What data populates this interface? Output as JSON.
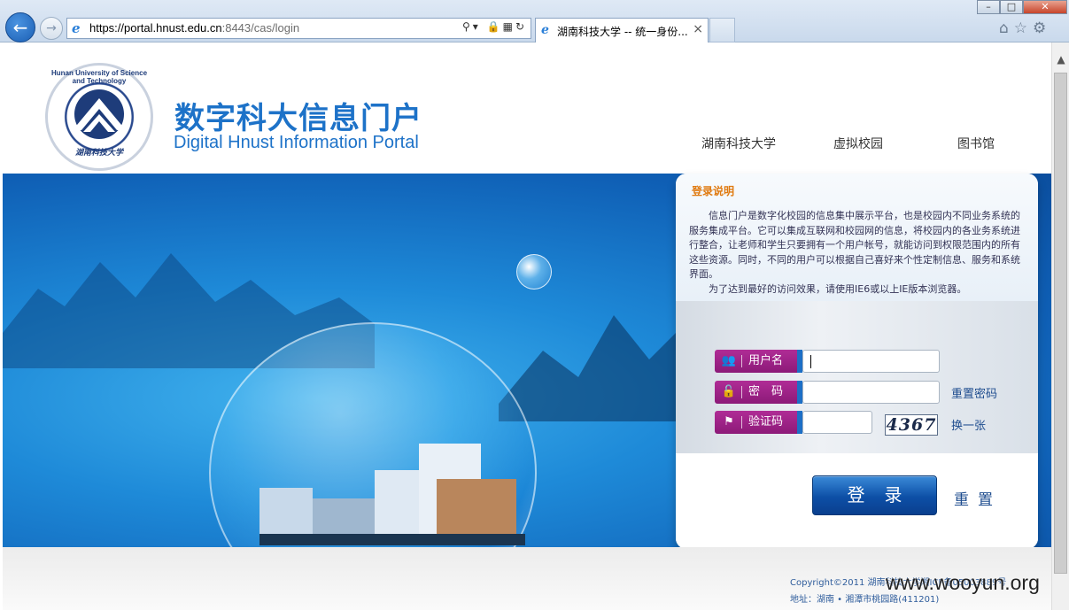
{
  "browser": {
    "url_host": "https://portal.hnust.edu.cn",
    "url_rest": ":8443/cas/login",
    "tab_title": "湖南科技大学 -- 统一身份...",
    "tab_close": "×"
  },
  "header": {
    "logo_ring_text": "Hunan University of Science and Technology",
    "logo_seal_text": "湖南科技大学",
    "title_cn": "数字科大信息门户",
    "title_en": "Digital Hnust Information Portal",
    "nav": [
      "湖南科技大学",
      "虚拟校园",
      "图书馆"
    ]
  },
  "panel": {
    "title": "登录说明",
    "description_1": "信息门户是数字化校园的信息集中展示平台，也是校园内不同业务系统的服务集成平台。它可以集成互联网和校园网的信息，将校园内的各业务系统进行整合，让老师和学生只要拥有一个用户帐号，就能访问到权限范围内的所有这些资源。同时，不同的用户可以根据自己喜好来个性定制信息、服务和系统界面。",
    "description_2": "为了达到最好的访问效果，请使用IE6或以上IE版本浏览器。"
  },
  "form": {
    "username_label": "用户名",
    "password_label": "密　码",
    "captcha_label": "验证码",
    "username_value": "",
    "password_value": "",
    "captcha_value": "",
    "captcha_image_text": "4367",
    "reset_password_link": "重置密码",
    "refresh_captcha_link": "换一张",
    "login_button": "登录",
    "reset_button": "重置"
  },
  "footer": {
    "copyright": "Copyright©2011 湖南科技大学湘ICP备05003889号",
    "address": "地址：湖南 • 湘潭市桃园路(411201)"
  },
  "watermark": "www.wooyun.org",
  "colors": {
    "brand_blue": "#1d72c8",
    "label_magenta": "#a0238a",
    "title_orange": "#e07a10"
  }
}
